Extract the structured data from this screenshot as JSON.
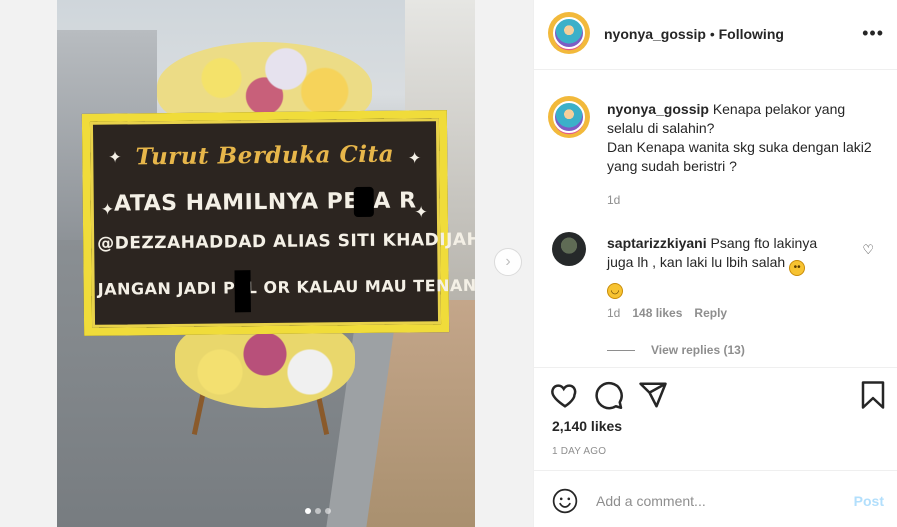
{
  "post": {
    "username": "nyonya_gossip",
    "follow_status": "Following",
    "more_icon": "more-horizontal-icon"
  },
  "board": {
    "title": "Turut Berduka Cita",
    "line1": "ATAS HAMILNYA PELA  R",
    "line2": "@DEZZAHADDAD ALIAS SITI KHADIJAH",
    "line3": "JANGAN JADI PEL  OR KALAU MAU TENANG"
  },
  "carousel": {
    "slides": 3,
    "active": 1,
    "next_icon": "chevron-right-icon",
    "next_symbol": "›"
  },
  "caption": {
    "username": "nyonya_gossip",
    "text_line1": "Kenapa pelakor yang selalu di salahin?",
    "text_line2": "Dan Kenapa wanita skg suka dengan laki2 yang sudah beristri ?",
    "time": "1d"
  },
  "comment": {
    "username": "saptarizzkiyani",
    "text": "Psang fto lakinya juga lh , kan laki lu lbih salah",
    "emoji1": "🙄",
    "emoji2": "🤣",
    "time": "1d",
    "likes": "148 likes",
    "reply": "Reply",
    "view_replies": "View replies (13)"
  },
  "actions": {
    "likes": "2,140 likes",
    "time_ago": "1 DAY AGO"
  },
  "add_comment": {
    "placeholder": "Add a comment...",
    "post_label": "Post"
  }
}
